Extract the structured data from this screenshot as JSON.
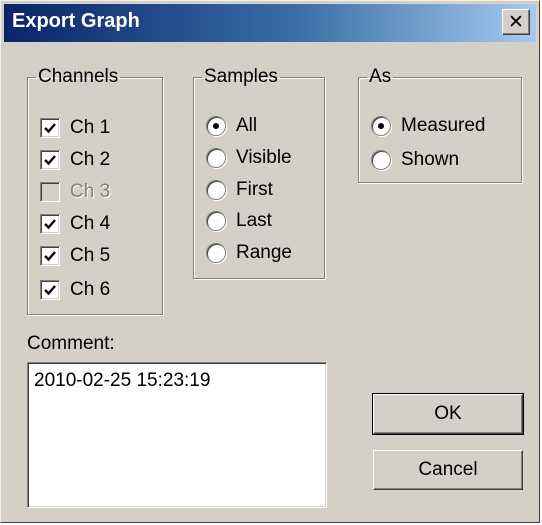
{
  "dialog": {
    "title": "Export Graph",
    "close_glyph": "✕"
  },
  "channels": {
    "legend": "Channels",
    "items": [
      {
        "label": "Ch 1",
        "checked": true,
        "enabled": true
      },
      {
        "label": "Ch 2",
        "checked": true,
        "enabled": true
      },
      {
        "label": "Ch 3",
        "checked": false,
        "enabled": false
      },
      {
        "label": "Ch 4",
        "checked": true,
        "enabled": true
      },
      {
        "label": "Ch 5",
        "checked": true,
        "enabled": true
      },
      {
        "label": "Ch 6",
        "checked": true,
        "enabled": true
      }
    ]
  },
  "samples": {
    "legend": "Samples",
    "options": [
      {
        "label": "All",
        "selected": true
      },
      {
        "label": "Visible",
        "selected": false
      },
      {
        "label": "First",
        "selected": false
      },
      {
        "label": "Last",
        "selected": false
      },
      {
        "label": "Range",
        "selected": false
      }
    ]
  },
  "as": {
    "legend": "As",
    "options": [
      {
        "label": "Measured",
        "selected": true
      },
      {
        "label": "Shown",
        "selected": false
      }
    ]
  },
  "comment": {
    "label": "Comment:",
    "value": "2010-02-25 15:23:19"
  },
  "buttons": {
    "ok": "OK",
    "cancel": "Cancel"
  },
  "colors": {
    "face": "#d4d0c8",
    "title_gradient_start": "#0a246a",
    "title_gradient_end": "#a6caf0"
  }
}
